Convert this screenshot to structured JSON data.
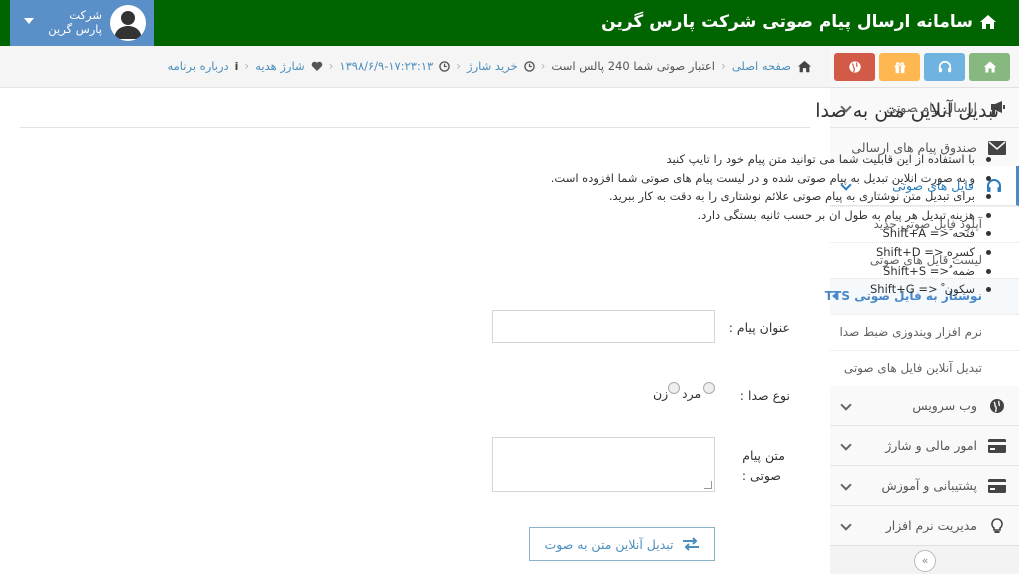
{
  "header": {
    "title": "سامانه ارسال پیام صوتی شرکت پارس گرین",
    "user_line1": "شرکت",
    "user_line2": "پارس گرین"
  },
  "shortcuts": [
    "home-icon",
    "headphones-icon",
    "gift-icon",
    "globe-icon"
  ],
  "breadcrumb": {
    "home": "صفحه اصلی",
    "credit": "اعتبار صوتی شما 240 پالس است",
    "buy_charge": "خرید شارژ",
    "datetime": "۱۳۹۸/۶/۹-۱۷:۲۳:۱۳",
    "gift_charge": "شارژ هدیه",
    "about": "درباره برنامه"
  },
  "sidebar": {
    "items": [
      {
        "label": "ارسال پیام صوتی",
        "icon": "bullhorn-icon"
      },
      {
        "label": "صندوق پیام های ارسالی",
        "icon": "envelope-icon"
      },
      {
        "label": "فایل های صوتی",
        "icon": "headphones-icon"
      },
      {
        "label": "وب سرویس",
        "icon": "globe-icon"
      },
      {
        "label": "امور مالی و شارژ",
        "icon": "credit-card-icon"
      },
      {
        "label": "پشتیبانی و آموزش",
        "icon": "credit-card-icon"
      },
      {
        "label": "مدیریت نرم افزار",
        "icon": "lightbulb-icon"
      }
    ],
    "submenu": [
      "آپلود فایل صوتی جدید",
      "لیست فایل های صوتی",
      "نوشتار به فایل صوتی TTS",
      "نرم افزار ویندوزی ضبط صدا",
      "تبدیل آنلاین فایل های صوتی"
    ],
    "collapse": "«"
  },
  "main": {
    "title": "تبدیل آنلاین متن به صدا",
    "help": [
      "با استفاده از این قابلیت شما می توانید متن پیام خود را تایپ کنید",
      "و به صورت انلاین تبدیل به پیام صوتی شده و در لیست  پیام های صوتی شما افزوده است.",
      "برای تبدیل متن نوشتاری به پیام صوتی علائم نوشتاری را به دقت به کار ببرید.",
      "هزینه تبدیل هر پیام به طول ان بر حسب ثانیه بستگی دارد.",
      "فتحه َ<= Shift+A",
      "کسره ِ<= Shift+D",
      "ضمه ُ<= Shift+S",
      "سکون ْ <= Shift+G"
    ],
    "form": {
      "title_label": "عنوان پیام :",
      "title_value": "",
      "voice_label": "نوع صدا :",
      "voice_male": "مرد",
      "voice_female": "زن",
      "text_label_1": "متن پیام",
      "text_label_2": "صوتی :",
      "text_value": "",
      "submit": "تبدیل آنلاین متن به صوت"
    }
  }
}
